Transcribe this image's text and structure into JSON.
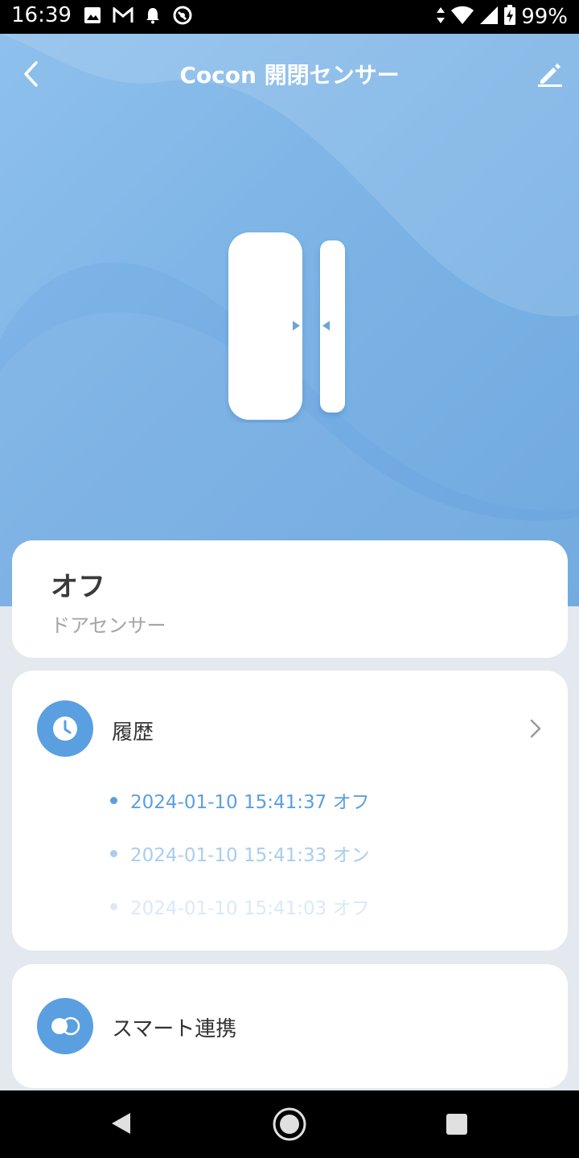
{
  "status_bar": {
    "time": "16:39",
    "left_icons": [
      "image-icon",
      "gmail-icon",
      "bell-icon",
      "sync-icon"
    ],
    "right_icons": [
      "data-arrows-icon",
      "wifi-icon",
      "signal-icon",
      "battery-charging-icon"
    ],
    "battery": "99%"
  },
  "header": {
    "title": "Cocon 開閉センサー",
    "back_icon": "chevron-left-icon",
    "edit_icon": "pencil-icon"
  },
  "device": {
    "illustration": "door-sensor-illustration",
    "state": "オフ",
    "type": "ドアセンサー"
  },
  "history": {
    "label": "履歴",
    "icon": "clock-icon",
    "entries": [
      {
        "text": "2024-01-10 15:41:37 オフ",
        "color": "#5a9fe0"
      },
      {
        "text": "2024-01-10 15:41:33 オン",
        "color": "#a9cdef"
      },
      {
        "text": "2024-01-10 15:41:03 オフ",
        "color": "#dbe9f7"
      }
    ]
  },
  "smart": {
    "label": "スマート連携",
    "icon": "toggle-link-icon"
  },
  "colors": {
    "accent": "#5a9fe0",
    "hero_top": "#8ec0ec",
    "hero_bottom": "#6fa9df",
    "page_bg": "#e3e9ef"
  },
  "nav": {
    "icons": [
      "nav-back-icon",
      "nav-home-icon",
      "nav-recent-icon"
    ]
  }
}
